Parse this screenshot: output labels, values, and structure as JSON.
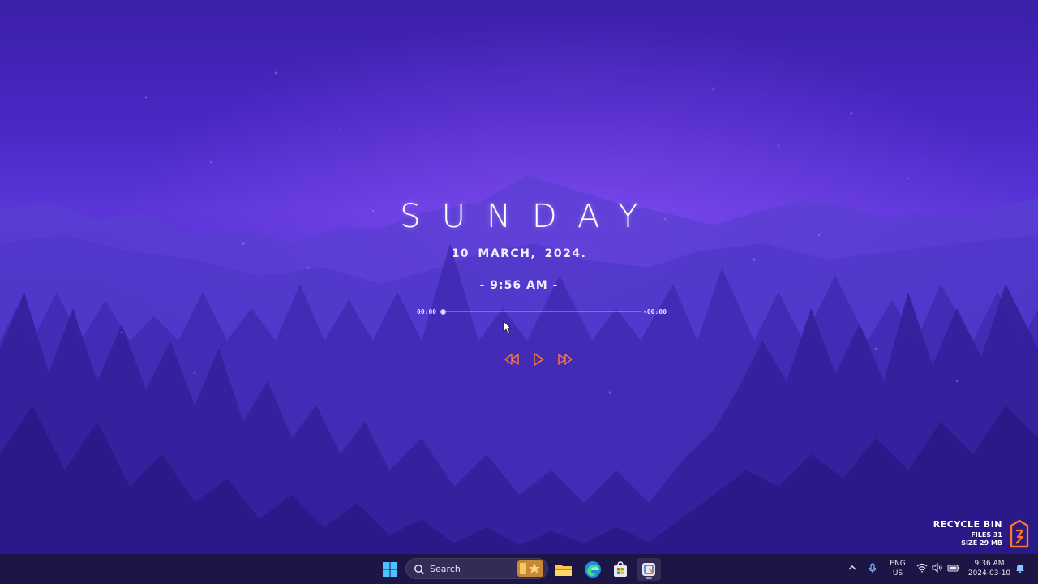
{
  "widget": {
    "day": "SUNDAY",
    "date": "10 MARCH, 2024.",
    "time": "- 9:56 AM -",
    "media": {
      "elapsed": "00:00",
      "remaining": "-00:00",
      "progress": 0,
      "controls": [
        "previous-icon",
        "play-icon",
        "next-icon"
      ],
      "control_color": "#ff7a3d"
    }
  },
  "recycle_bin": {
    "title": "RECYCLE BIN",
    "files": "FILES 31",
    "size": "SIZE 29 MB",
    "accent": "#ff7a1f"
  },
  "taskbar": {
    "search_placeholder": "Search",
    "apps": [
      "start-icon",
      "file-explorer-icon",
      "edge-icon",
      "microsoft-store-icon",
      "snipping-tool-icon"
    ],
    "tray": {
      "language": "ENG",
      "region": "US",
      "time": "9:36 AM",
      "date": "2024-03-10"
    }
  }
}
